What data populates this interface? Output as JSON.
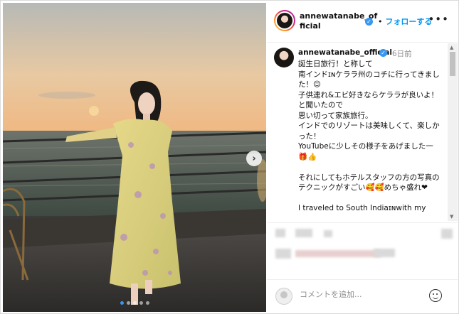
{
  "post": {
    "username": "annewatanabe_official",
    "header_username": "annewatanabe_of\nficial",
    "follow_label": "フォローする",
    "follow_separator": "•",
    "more_icon": "more-horizontal-icon",
    "time_ago": "6日前",
    "caption": "誕生日旅行！と称して\n南インドɪɴケララ州のコチに行ってきました！☺\n子供連れ&エビ好きならケララが良いよ！と聞いたので\n思い切って家族旅行。\nインドでのリゾートは美味しくて、楽しかった！\nYouTubeに少しその様子をあげました一🎁👍\n\nそれにしてもホテルスタッフの方の写真のテクニックがすごい🥰🥰めちゃ盛れ❤\n\nI traveled to South Indiaɪɴwith my",
    "carousel": {
      "total": 5,
      "active_index": 0
    }
  },
  "comment": {
    "placeholder": "コメントを追加..."
  },
  "icons": {
    "next": "chevron-right-icon",
    "verified": "verified-badge-icon",
    "emoji": "emoji-smile-icon"
  },
  "colors": {
    "accent": "#0095f6",
    "verified": "#3897f0"
  }
}
